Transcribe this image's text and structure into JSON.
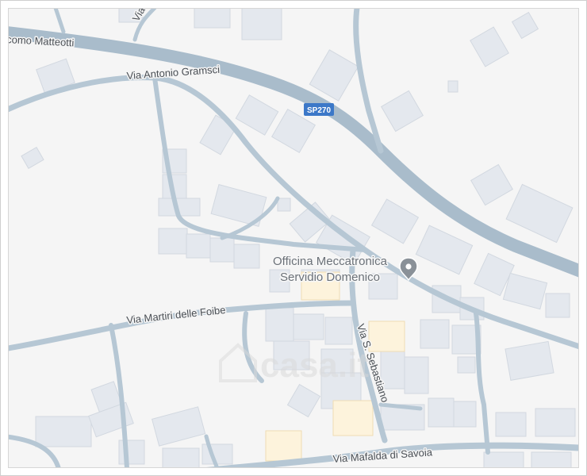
{
  "map": {
    "colors": {
      "background": "#f5f5f5",
      "road": "#b6c7d4",
      "building": "#e4e8ee",
      "highlight_building": "#fdf3dc",
      "route_shield": "#3c78c8",
      "poi_marker": "#8a9198"
    },
    "streets": {
      "matteotti": "como Matteotti",
      "gramsci": "Via Antonio Gramsci",
      "martiri": "Via Martiri delle Foibe",
      "sebastiano": "Via S. Sebastiano",
      "mafalda": "Via Mafalda di Savoia",
      "top_partial": "Via"
    },
    "route_shield": {
      "label": "SP270"
    },
    "poi": {
      "line1": "Officina Meccatronica",
      "line2": "Servidio Domenico",
      "icon": "map-pin-icon"
    },
    "watermark": {
      "text": "casa.it"
    }
  }
}
